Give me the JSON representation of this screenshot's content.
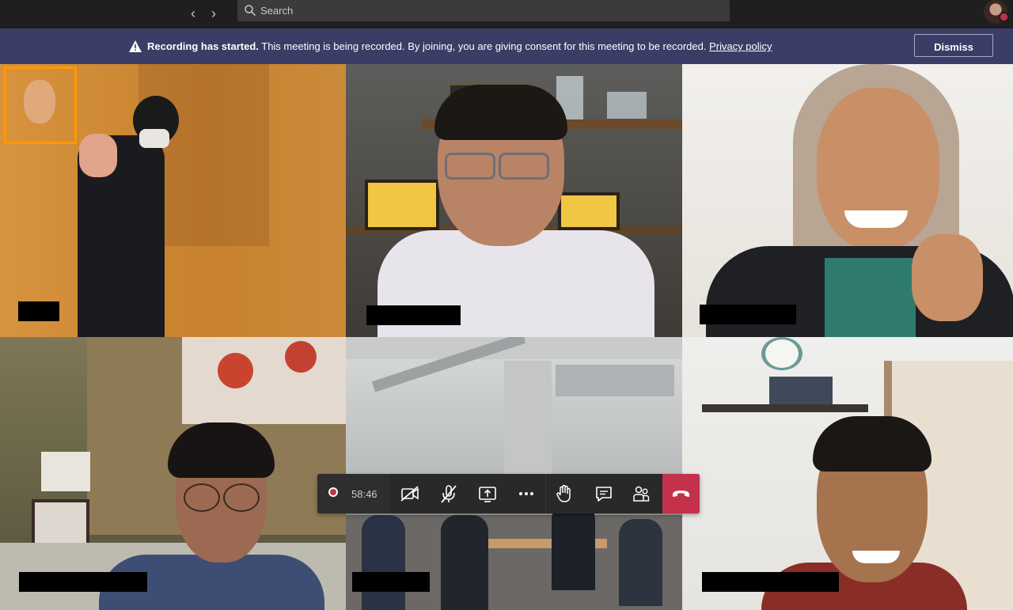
{
  "topbar": {
    "search_placeholder": "Search",
    "back_glyph": "‹",
    "forward_glyph": "›"
  },
  "banner": {
    "bold": "Recording has started.",
    "message": " This meeting is being recorded. By joining, you are giving consent for this meeting to be recorded. ",
    "link": "Privacy policy",
    "dismiss_label": "Dismiss"
  },
  "controls": {
    "timer": "58:46",
    "buttons": [
      "camera-off-icon",
      "mic-off-icon",
      "share-screen-icon",
      "more-icon",
      "raise-hand-icon",
      "chat-icon",
      "participants-icon",
      "hang-up-icon"
    ]
  },
  "colors": {
    "banner_bg": "#3a3d66",
    "hangup": "#c4314b",
    "pinned_frame": "#ff9900"
  }
}
